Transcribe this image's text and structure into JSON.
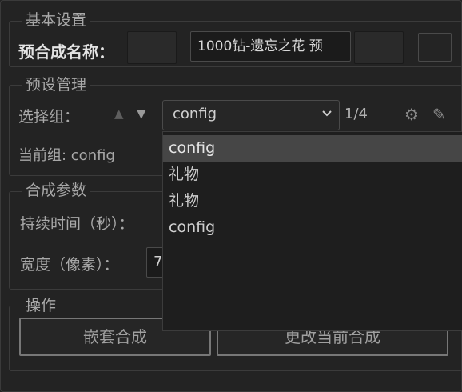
{
  "basic": {
    "legend": "基本设置",
    "name_label": "预合成名称：",
    "name_value": "1000钻-遗忘之花 预"
  },
  "preset": {
    "legend": "预设管理",
    "select_label": "选择组：",
    "selected": "config",
    "counter": "1/4",
    "current_group": "当前组: config",
    "options": [
      "config",
      "礼物",
      "礼物",
      "config"
    ]
  },
  "params": {
    "legend": "合成参数",
    "duration_label": "持续时间（秒）：",
    "width_label": "宽度（像素）：",
    "width_value_partial": "7"
  },
  "actions": {
    "legend": "操作",
    "nest_button": "嵌套合成",
    "modify_button": "更改当前合成"
  }
}
